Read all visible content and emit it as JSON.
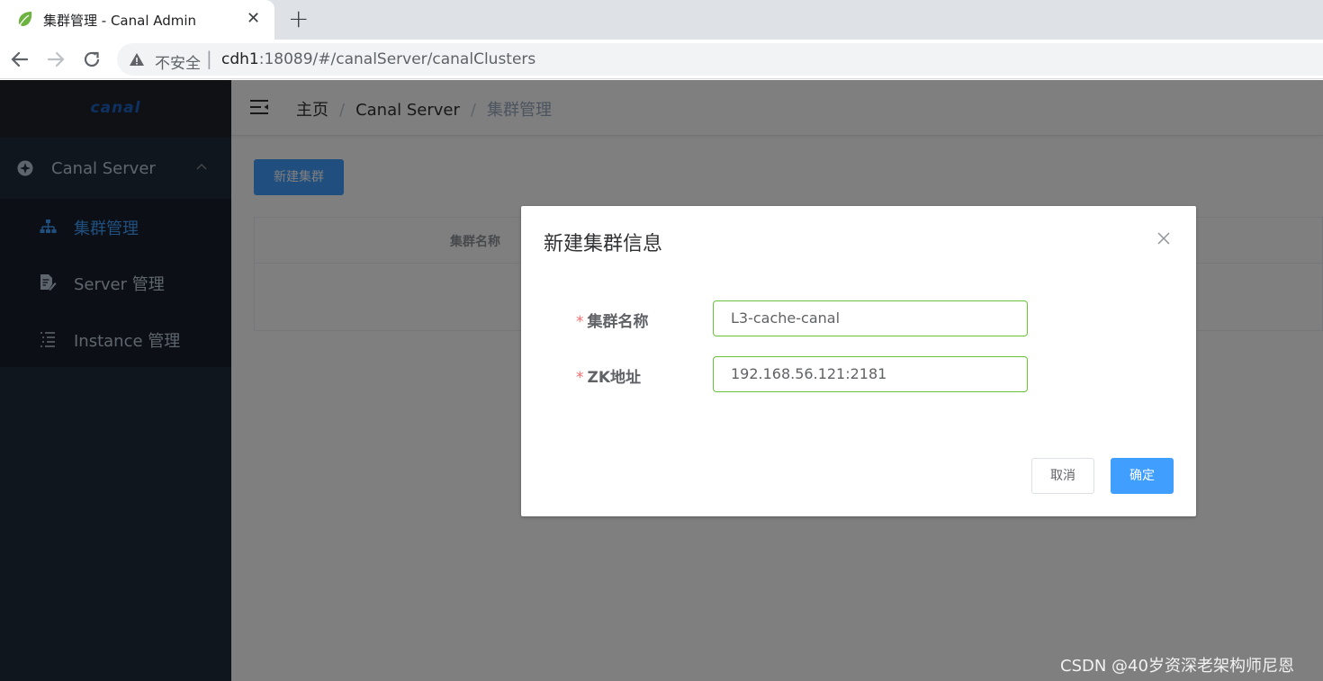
{
  "browser": {
    "tab_title": "集群管理 - Canal Admin",
    "tab_close": "✕",
    "new_tab": "+",
    "insecure_label": "不安全",
    "separator": "|",
    "url_host": "cdh1",
    "url_rest": ":18089/#/canalServer/canalClusters"
  },
  "sidebar": {
    "logo": "canal",
    "parent_label": "Canal Server",
    "items": [
      {
        "label": "集群管理",
        "icon": "sitemap-icon",
        "active": true
      },
      {
        "label": "Server 管理",
        "icon": "document-edit-icon",
        "active": false
      },
      {
        "label": "Instance 管理",
        "icon": "list-icon",
        "active": false
      }
    ]
  },
  "navbar": {
    "breadcrumb": [
      "主页",
      "Canal Server",
      "集群管理"
    ],
    "separator": "/"
  },
  "page": {
    "new_button": "新建集群",
    "table_headers": [
      "集群名称"
    ]
  },
  "dialog": {
    "title": "新建集群信息",
    "required_mark": "*",
    "fields": [
      {
        "label": "集群名称",
        "value": "L3-cache-canal"
      },
      {
        "label": "ZK地址",
        "value": "192.168.56.121:2181"
      }
    ],
    "cancel_label": "取消",
    "confirm_label": "确定"
  },
  "watermark": "CSDN @40岁资深老架构师尼恩",
  "colors": {
    "primary": "#409eff",
    "sidebar_bg": "#1f2d3d",
    "valid_border": "#67c23a",
    "required": "#f56c6c"
  }
}
